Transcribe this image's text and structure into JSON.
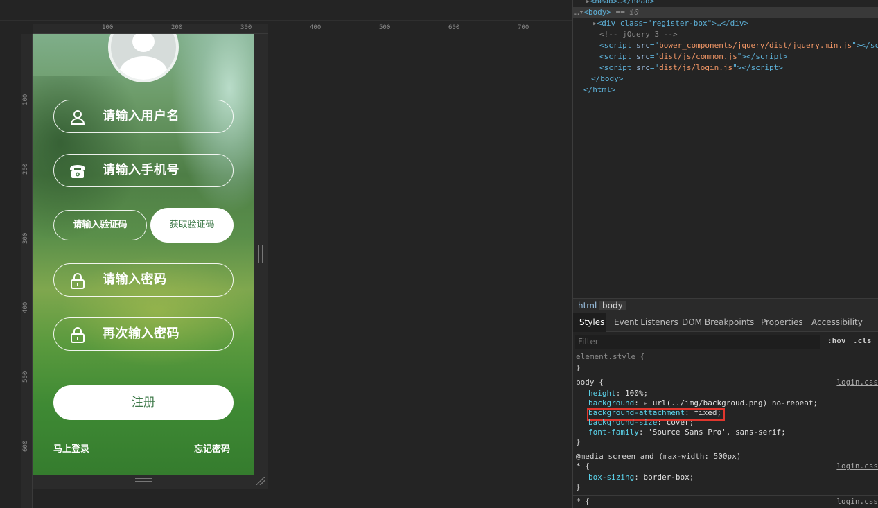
{
  "ruler": {
    "h": [
      "100",
      "200",
      "300",
      "400",
      "500",
      "600",
      "700"
    ],
    "v": [
      "100",
      "200",
      "300",
      "400",
      "500",
      "600"
    ]
  },
  "page": {
    "fields": [
      {
        "icon": "user-icon",
        "placeholder": "请输入用户名"
      },
      {
        "icon": "phone-icon",
        "placeholder": "请输入手机号"
      },
      {
        "icon": "lock-icon",
        "placeholder": "请输入密码"
      },
      {
        "icon": "lock-icon",
        "placeholder": "再次输入密码"
      }
    ],
    "code_placeholder": "请输入验证码",
    "get_code": "获取验证码",
    "register": "注册",
    "login_link": "马上登录",
    "forgot_link": "忘记密码"
  },
  "elements": {
    "lines": [
      {
        "tag": "<head>…</head>"
      },
      {
        "body": "<body>",
        "eq": " == $0"
      },
      {
        "div": "<div class=\"register-box\">…</div>"
      },
      {
        "comment": "<!-- jQuery 3 -->"
      },
      {
        "s1": "bower_components/jquery/dist/jquery.min.js"
      },
      {
        "s2": "dist/js/common.js"
      },
      {
        "s3": "dist/js/login.js"
      },
      {
        "end_body": "</body>"
      },
      {
        "end_html": "</html>"
      }
    ],
    "crumbs": [
      "html",
      "body"
    ],
    "tabs": [
      "Styles",
      "Event Listeners",
      "DOM Breakpoints",
      "Properties",
      "Accessibility"
    ],
    "filter_placeholder": "Filter",
    "hov": ":hov",
    "cls": ".cls"
  },
  "styles": {
    "element_style": "element.style {",
    "close": "}",
    "body_sel": "body {",
    "src1": "login.css",
    "body_props": [
      [
        "height",
        "100%;"
      ],
      [
        "background",
        "url(../img/backgroud.png) no-repeat;"
      ],
      [
        "background-attachment",
        "fixed;"
      ],
      [
        "background-size",
        "cover;"
      ],
      [
        "font-family",
        "'Source Sans Pro', sans-serif;"
      ]
    ],
    "media": "@media screen and (max-width: 500px)",
    "star": "* {",
    "src2": "login.css",
    "box_prop": [
      "box-sizing",
      "border-box;"
    ],
    "src3": "login.css"
  }
}
